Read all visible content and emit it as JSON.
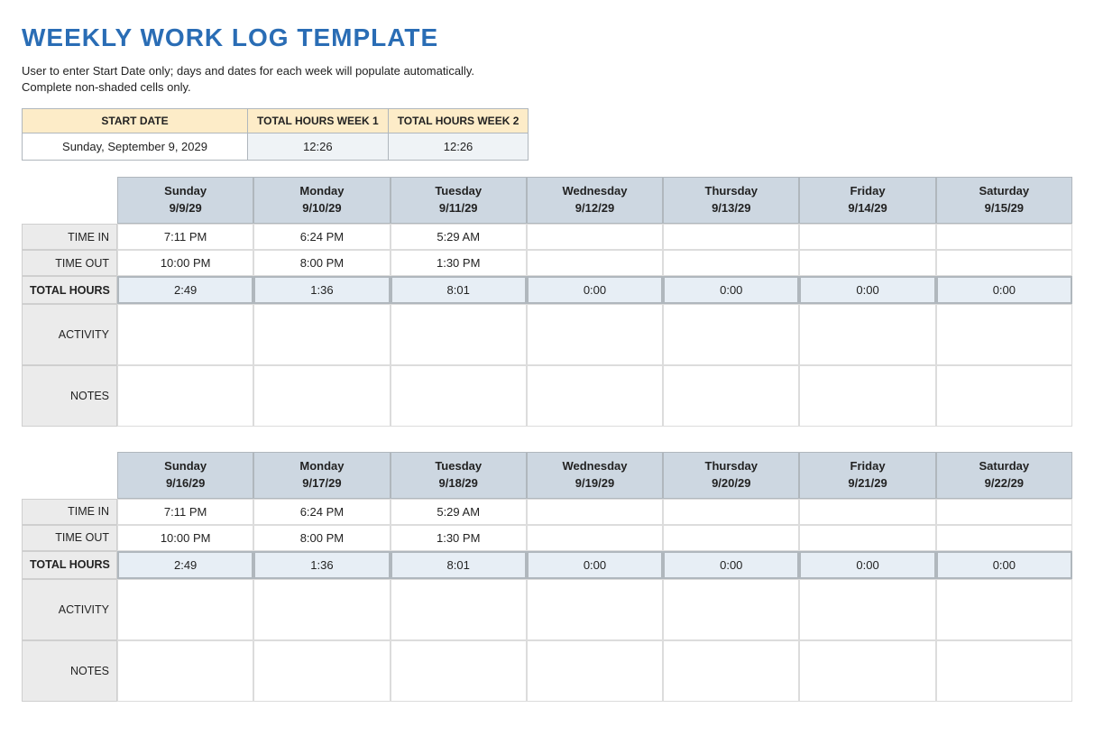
{
  "title": "WEEKLY WORK LOG TEMPLATE",
  "instructions_line1": "User to enter Start Date only; days and dates for each week will populate automatically.",
  "instructions_line2": "Complete non-shaded cells only.",
  "summary": {
    "headers": {
      "start_date": "START DATE",
      "week1": "TOTAL HOURS WEEK 1",
      "week2": "TOTAL HOURS WEEK 2"
    },
    "values": {
      "start_date": "Sunday, September 9, 2029",
      "week1": "12:26",
      "week2": "12:26"
    }
  },
  "row_labels": {
    "time_in": "TIME IN",
    "time_out": "TIME OUT",
    "total_hours": "TOTAL HOURS",
    "activity": "ACTIVITY",
    "notes": "NOTES"
  },
  "week1": {
    "days": [
      {
        "name": "Sunday",
        "date": "9/9/29",
        "time_in": "7:11 PM",
        "time_out": "10:00 PM",
        "total": "2:49",
        "activity": "",
        "notes": ""
      },
      {
        "name": "Monday",
        "date": "9/10/29",
        "time_in": "6:24 PM",
        "time_out": "8:00 PM",
        "total": "1:36",
        "activity": "",
        "notes": ""
      },
      {
        "name": "Tuesday",
        "date": "9/11/29",
        "time_in": "5:29 AM",
        "time_out": "1:30 PM",
        "total": "8:01",
        "activity": "",
        "notes": ""
      },
      {
        "name": "Wednesday",
        "date": "9/12/29",
        "time_in": "",
        "time_out": "",
        "total": "0:00",
        "activity": "",
        "notes": ""
      },
      {
        "name": "Thursday",
        "date": "9/13/29",
        "time_in": "",
        "time_out": "",
        "total": "0:00",
        "activity": "",
        "notes": ""
      },
      {
        "name": "Friday",
        "date": "9/14/29",
        "time_in": "",
        "time_out": "",
        "total": "0:00",
        "activity": "",
        "notes": ""
      },
      {
        "name": "Saturday",
        "date": "9/15/29",
        "time_in": "",
        "time_out": "",
        "total": "0:00",
        "activity": "",
        "notes": ""
      }
    ]
  },
  "week2": {
    "days": [
      {
        "name": "Sunday",
        "date": "9/16/29",
        "time_in": "7:11 PM",
        "time_out": "10:00 PM",
        "total": "2:49",
        "activity": "",
        "notes": ""
      },
      {
        "name": "Monday",
        "date": "9/17/29",
        "time_in": "6:24 PM",
        "time_out": "8:00 PM",
        "total": "1:36",
        "activity": "",
        "notes": ""
      },
      {
        "name": "Tuesday",
        "date": "9/18/29",
        "time_in": "5:29 AM",
        "time_out": "1:30 PM",
        "total": "8:01",
        "activity": "",
        "notes": ""
      },
      {
        "name": "Wednesday",
        "date": "9/19/29",
        "time_in": "",
        "time_out": "",
        "total": "0:00",
        "activity": "",
        "notes": ""
      },
      {
        "name": "Thursday",
        "date": "9/20/29",
        "time_in": "",
        "time_out": "",
        "total": "0:00",
        "activity": "",
        "notes": ""
      },
      {
        "name": "Friday",
        "date": "9/21/29",
        "time_in": "",
        "time_out": "",
        "total": "0:00",
        "activity": "",
        "notes": ""
      },
      {
        "name": "Saturday",
        "date": "9/22/29",
        "time_in": "",
        "time_out": "",
        "total": "0:00",
        "activity": "",
        "notes": ""
      }
    ]
  }
}
